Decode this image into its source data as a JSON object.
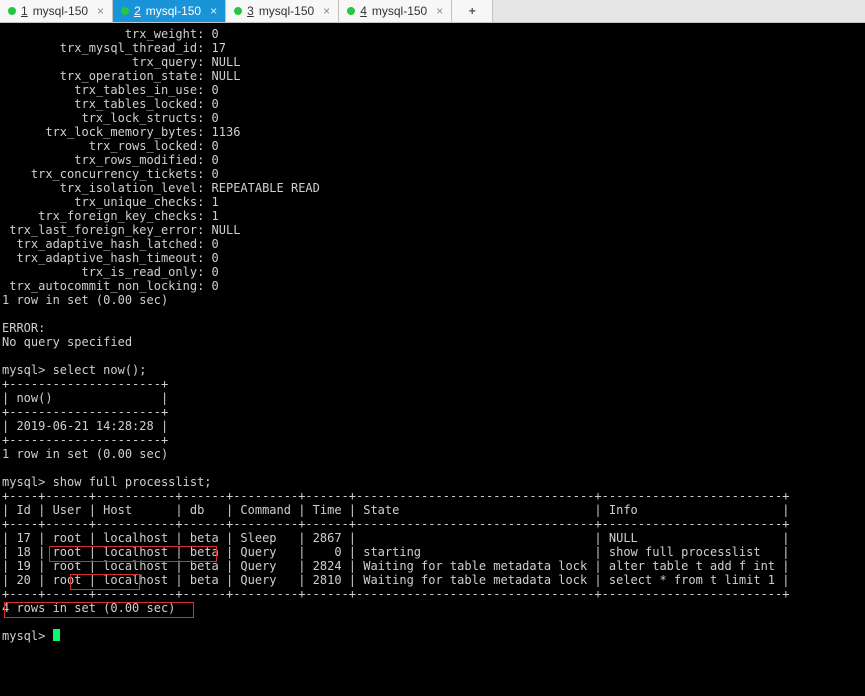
{
  "tabs": {
    "items": [
      {
        "index": "1",
        "label": "mysql-150",
        "active": false
      },
      {
        "index": "2",
        "label": "mysql-150",
        "active": true
      },
      {
        "index": "3",
        "label": "mysql-150",
        "active": false
      },
      {
        "index": "4",
        "label": "mysql-150",
        "active": false
      }
    ],
    "addLabel": "+"
  },
  "terminal": {
    "trx_lines": [
      {
        "key": "trx_weight",
        "value": "0"
      },
      {
        "key": "trx_mysql_thread_id",
        "value": "17"
      },
      {
        "key": "trx_query",
        "value": "NULL"
      },
      {
        "key": "trx_operation_state",
        "value": "NULL"
      },
      {
        "key": "trx_tables_in_use",
        "value": "0"
      },
      {
        "key": "trx_tables_locked",
        "value": "0"
      },
      {
        "key": "trx_lock_structs",
        "value": "0"
      },
      {
        "key": "trx_lock_memory_bytes",
        "value": "1136"
      },
      {
        "key": "trx_rows_locked",
        "value": "0"
      },
      {
        "key": "trx_rows_modified",
        "value": "0"
      },
      {
        "key": "trx_concurrency_tickets",
        "value": "0"
      },
      {
        "key": "trx_isolation_level",
        "value": "REPEATABLE READ"
      },
      {
        "key": "trx_unique_checks",
        "value": "1"
      },
      {
        "key": "trx_foreign_key_checks",
        "value": "1"
      },
      {
        "key": "trx_last_foreign_key_error",
        "value": "NULL"
      },
      {
        "key": "trx_adaptive_hash_latched",
        "value": "0"
      },
      {
        "key": "trx_adaptive_hash_timeout",
        "value": "0"
      },
      {
        "key": "trx_is_read_only",
        "value": "0"
      },
      {
        "key": "trx_autocommit_non_locking",
        "value": "0"
      }
    ],
    "trx_summary": "1 row in set (0.00 sec)",
    "error_heading": "ERROR:",
    "error_msg": "No query specified",
    "prompt": "mysql>",
    "cmd_now": "select now();",
    "now_col": "now()",
    "now_value": "2019-06-21 14:28:28",
    "now_summary": "1 row in set (0.00 sec)",
    "cmd_processlist": "show full processlist;",
    "pl_headers": [
      "Id",
      "User",
      "Host",
      "db",
      "Command",
      "Time",
      "State",
      "Info"
    ],
    "pl_rows": [
      {
        "Id": "17",
        "User": "root",
        "Host": "localhost",
        "db": "beta",
        "Command": "Sleep",
        "Time": "2867",
        "State": "",
        "Info": "NULL"
      },
      {
        "Id": "18",
        "User": "root",
        "Host": "localhost",
        "db": "beta",
        "Command": "Query",
        "Time": "0",
        "State": "starting",
        "Info": "show full processlist"
      },
      {
        "Id": "19",
        "User": "root",
        "Host": "localhost",
        "db": "beta",
        "Command": "Query",
        "Time": "2824",
        "State": "Waiting for table metadata lock",
        "Info": "alter table t add f int"
      },
      {
        "Id": "20",
        "User": "root",
        "Host": "localhost",
        "db": "beta",
        "Command": "Query",
        "Time": "2810",
        "State": "Waiting for table metadata lock",
        "Info": "select * from t limit 1"
      }
    ],
    "pl_summary": "4 rows in set (0.00 sec)"
  }
}
